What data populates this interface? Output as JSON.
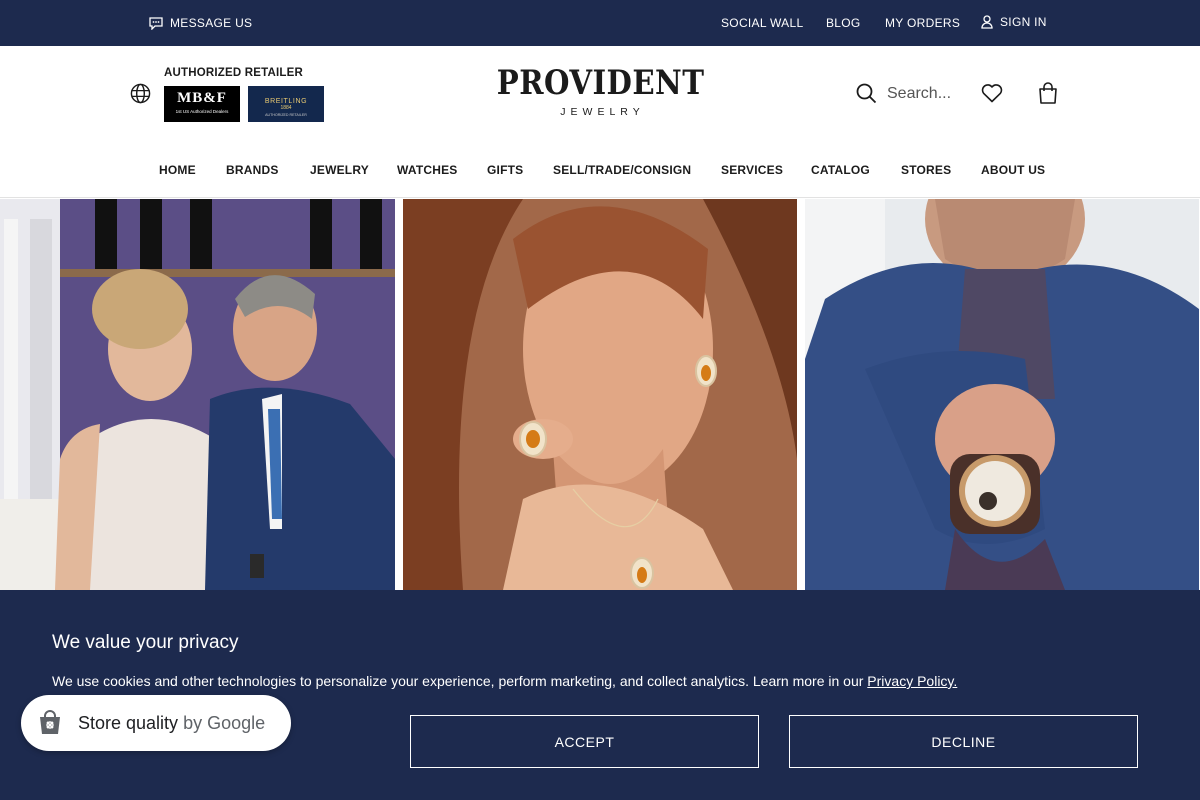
{
  "topbar": {
    "message_label": "MESSAGE US",
    "links": [
      "SOCIAL WALL",
      "BLOG",
      "MY ORDERS"
    ],
    "signin_label": "SIGN IN"
  },
  "header": {
    "authorized_label": "AUTHORIZED RETAILER",
    "badge_mbf": {
      "name": "MB&F",
      "tagline": "1st US Authorized Dealers"
    },
    "badge_breitling": {
      "name": "BREITLING",
      "year": "1884",
      "tagline": "AUTHORIZED RETAILER"
    },
    "logo_name": "PROVIDENT",
    "logo_sub": "JEWELRY",
    "search_placeholder": "Search..."
  },
  "nav": [
    "HOME",
    "BRANDS",
    "JEWELRY",
    "WATCHES",
    "GIFTS",
    "SELL/TRADE/CONSIGN",
    "SERVICES",
    "CATALOG",
    "STORES",
    "ABOUT US"
  ],
  "cookie": {
    "title": "We value your privacy",
    "text": "We use cookies and other technologies to personalize your experience, perform marketing, and collect analytics. Learn more in our",
    "link": "Privacy Policy.",
    "accept": "ACCEPT",
    "decline": "DECLINE"
  },
  "google_badge": {
    "label": "Store quality",
    "by": "by Google"
  },
  "colors": {
    "navy": "#1d2a4e",
    "white": "#ffffff",
    "text": "#1b1b1b"
  },
  "icons": [
    "chat-icon",
    "user-icon",
    "globe-icon",
    "search-icon",
    "heart-icon",
    "bag-icon",
    "google-shopping-icon"
  ]
}
